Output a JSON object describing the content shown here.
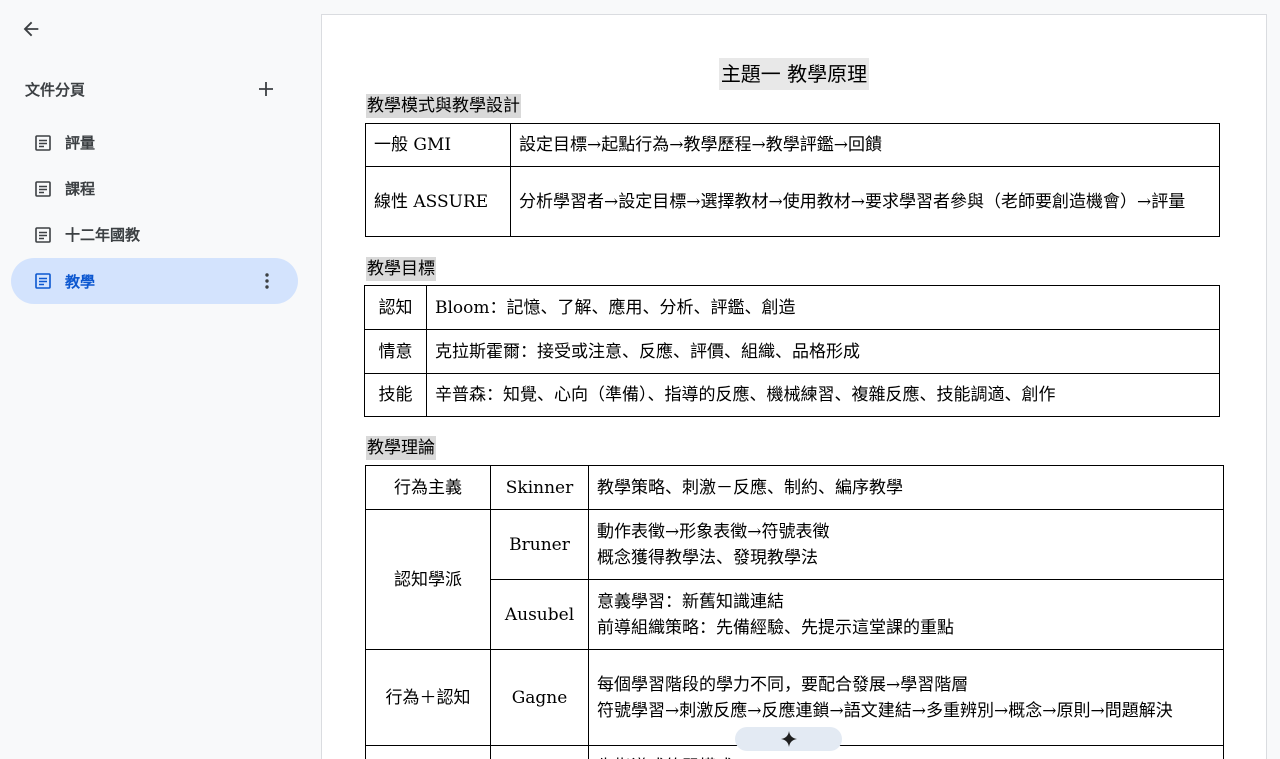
{
  "sidebar": {
    "title": "文件分頁",
    "tabs": [
      {
        "label": "評量"
      },
      {
        "label": "課程"
      },
      {
        "label": "十二年國教"
      },
      {
        "label": "教學"
      }
    ]
  },
  "doc": {
    "title": "主題一 教學原理",
    "section1": {
      "heading": "教學模式與教學設計",
      "rows": [
        {
          "name": "一般 GMI",
          "desc": "設定目標→起點行為→教學歷程→教學評鑑→回饋"
        },
        {
          "name": "線性 ASSURE",
          "desc": "分析學習者→設定目標→選擇教材→使用教材→要求學習者參與（老師要創造機會）→評量"
        }
      ]
    },
    "section2": {
      "heading": "教學目標",
      "rows": [
        {
          "name": "認知",
          "desc": "Bloom：記憶、了解、應用、分析、評鑑、創造"
        },
        {
          "name": "情意",
          "desc": "克拉斯霍爾：接受或注意、反應、評價、組織、品格形成"
        },
        {
          "name": "技能",
          "desc": "辛普森：知覺、心向（準備）、指導的反應、機械練習、複雜反應、技能調適、創作"
        }
      ]
    },
    "section3": {
      "heading": "教學理論",
      "rows": [
        {
          "school": "行為主義",
          "person": "Skinner",
          "lines": [
            "教學策略、刺激－反應、制約、編序教學"
          ]
        },
        {
          "school": "認知學派",
          "person": "Bruner",
          "lines": [
            "動作表徵→形象表徵→符號表徵",
            "概念獲得教學法、發現教學法"
          ]
        },
        {
          "person": "Ausubel",
          "lines": [
            "意義學習：新舊知識連結",
            "前導組織策略：先備經驗、先提示這堂課的重點"
          ]
        },
        {
          "school": "行為＋認知",
          "person": "Gagne",
          "lines": [
            "每個學習階段的學力不同，要配合發展→學習階層",
            "符號學習→刺激反應→反應連鎖→語文建結→多重辨別→概念→原則→問題解決"
          ]
        },
        {
          "lines": [
            "先指導式的習模式"
          ]
        }
      ]
    }
  }
}
